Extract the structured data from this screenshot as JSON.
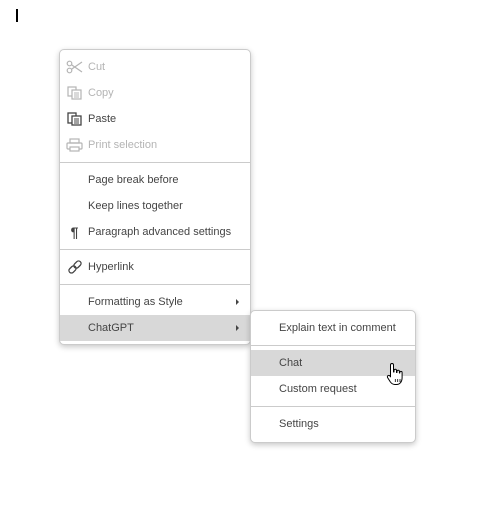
{
  "context_menu": {
    "cut": "Cut",
    "copy": "Copy",
    "paste": "Paste",
    "print_selection": "Print selection",
    "page_break_before": "Page break before",
    "keep_lines_together": "Keep lines together",
    "paragraph_advanced_settings": "Paragraph advanced settings",
    "paragraph_icon": "¶",
    "hyperlink": "Hyperlink",
    "formatting_as_style": "Formatting as Style",
    "chatgpt": "ChatGPT"
  },
  "chatgpt_submenu": {
    "explain_text_in_comment": "Explain text in comment",
    "chat": "Chat",
    "custom_request": "Custom request",
    "settings": "Settings"
  },
  "icons": {
    "cut": "scissors-icon",
    "copy": "copy-icon",
    "paste": "paste-icon",
    "print": "printer-icon",
    "paragraph": "pilcrow-icon",
    "hyperlink": "link-icon",
    "submenu": "chevron-right-icon",
    "pointer": "hand-pointer-icon"
  },
  "colors": {
    "text": "#444444",
    "disabled_text": "#b4b4b4",
    "highlight": "#d8d8d8",
    "border": "#cbcbcb"
  }
}
